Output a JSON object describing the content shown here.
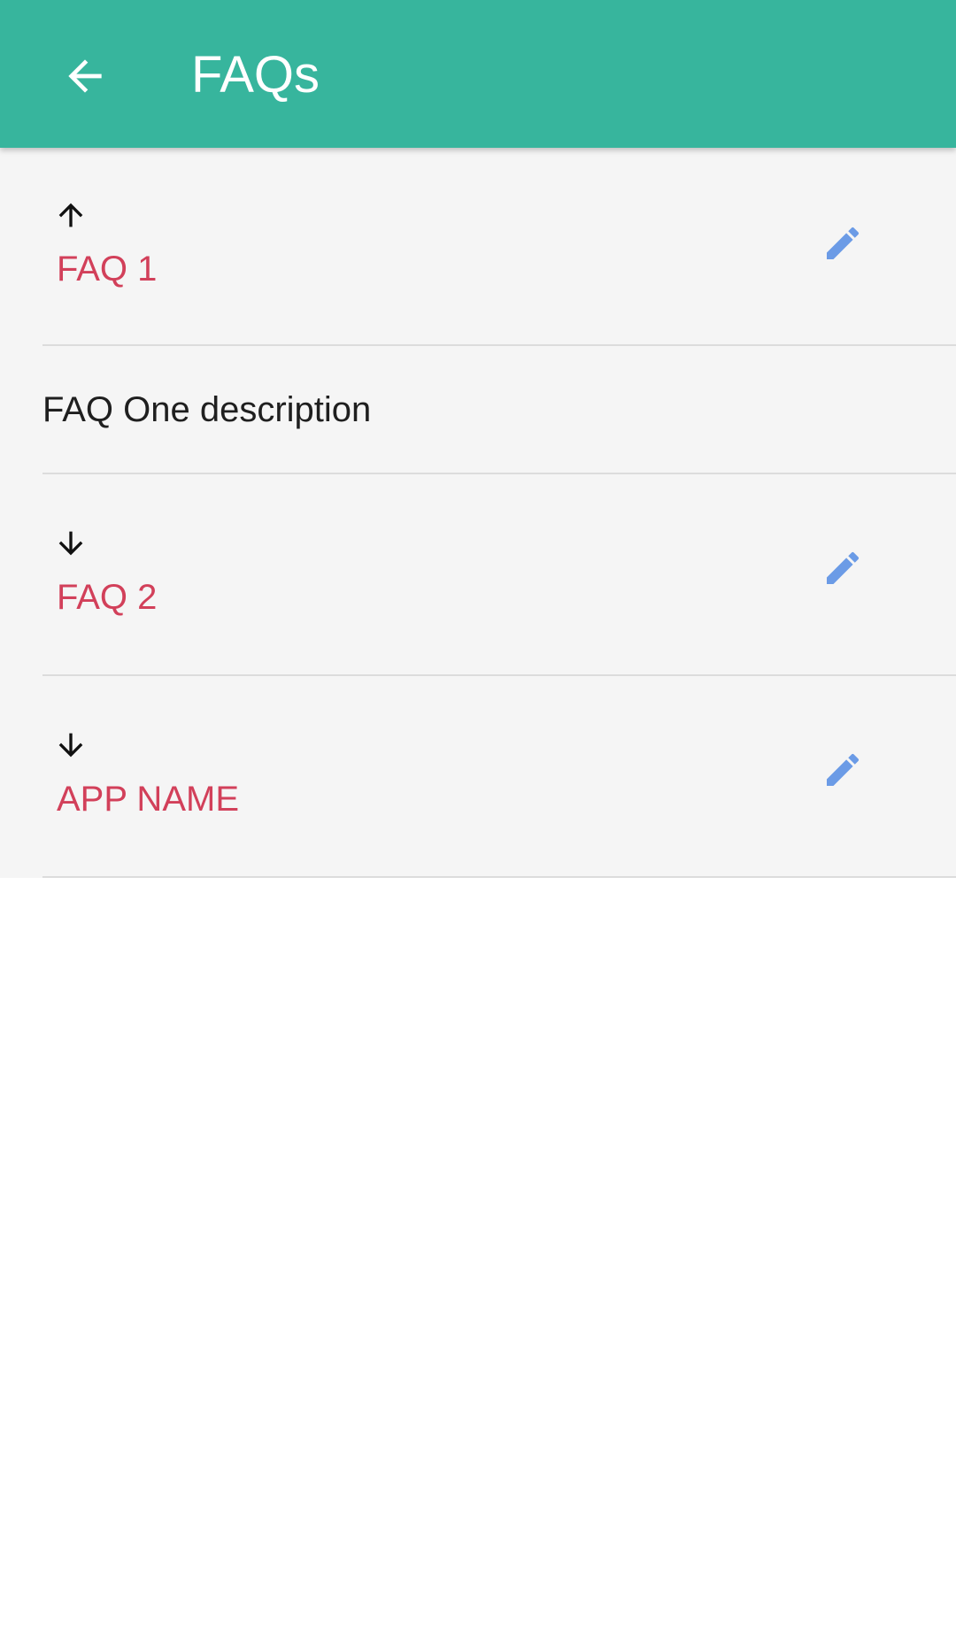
{
  "appbar": {
    "title": "FAQs",
    "back_icon": "arrow-back-icon",
    "background_color": "#37b59d"
  },
  "faqs": [
    {
      "title": "FAQ 1",
      "expanded": true,
      "toggle_icon": "arrow-up-icon",
      "edit_icon": "pencil-icon",
      "description": "FAQ One description"
    },
    {
      "title": "FAQ 2",
      "expanded": false,
      "toggle_icon": "arrow-down-icon",
      "edit_icon": "pencil-icon"
    },
    {
      "title": "APP NAME",
      "expanded": false,
      "toggle_icon": "arrow-down-icon",
      "edit_icon": "pencil-icon"
    }
  ],
  "colors": {
    "title_text": "#d2405a",
    "edit_icon": "#6b9be6",
    "list_background": "#f5f5f5"
  }
}
